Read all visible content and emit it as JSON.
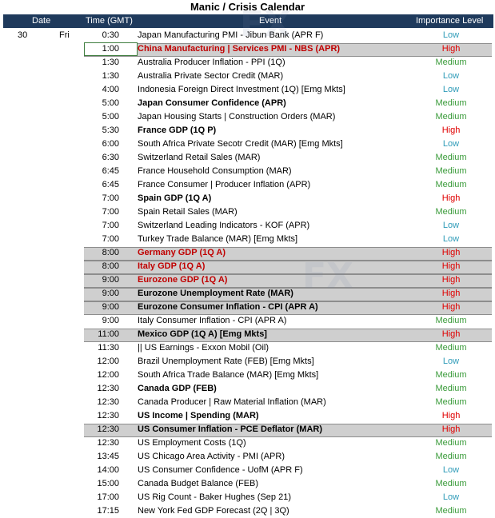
{
  "title": "Manic / Crisis Calendar",
  "headers": {
    "date": "Date",
    "time": "Time (GMT)",
    "event": "Event",
    "importance": "Importance Level"
  },
  "date": {
    "day": "30",
    "weekday": "Fri"
  },
  "rows": [
    {
      "time": "0:30",
      "event": "Japan Manufacturing PMI - Jibun Bank (APR F)",
      "importance": "Low",
      "bold": false,
      "highlight": false,
      "red": false
    },
    {
      "time": "1:00",
      "event": "China Manufacturing | Services PMI - NBS (APR)",
      "importance": "High",
      "bold": true,
      "highlight": true,
      "red": true,
      "selected": true
    },
    {
      "time": "1:30",
      "event": "Australia Producer Inflation - PPI (1Q)",
      "importance": "Medium",
      "bold": false,
      "highlight": false,
      "red": false
    },
    {
      "time": "1:30",
      "event": "Australia Private Sector Credit (MAR)",
      "importance": "Low",
      "bold": false,
      "highlight": false,
      "red": false
    },
    {
      "time": "4:00",
      "event": "Indonesia Foreign Direct Investment (1Q) [Emg Mkts]",
      "importance": "Low",
      "bold": false,
      "highlight": false,
      "red": false
    },
    {
      "time": "5:00",
      "event": "Japan Consumer Confidence (APR)",
      "importance": "Medium",
      "bold": true,
      "highlight": false,
      "red": false
    },
    {
      "time": "5:00",
      "event": "Japan Housing Starts | Construction Orders (MAR)",
      "importance": "Medium",
      "bold": false,
      "highlight": false,
      "red": false
    },
    {
      "time": "5:30",
      "event": "France GDP (1Q P)",
      "importance": "High",
      "bold": true,
      "highlight": false,
      "red": false
    },
    {
      "time": "6:00",
      "event": "South Africa Private Secotr Credit (MAR) [Emg Mkts]",
      "importance": "Low",
      "bold": false,
      "highlight": false,
      "red": false
    },
    {
      "time": "6:30",
      "event": "Switzerland Retail Sales (MAR)",
      "importance": "Medium",
      "bold": false,
      "highlight": false,
      "red": false
    },
    {
      "time": "6:45",
      "event": "France Household Consumption (MAR)",
      "importance": "Medium",
      "bold": false,
      "highlight": false,
      "red": false
    },
    {
      "time": "6:45",
      "event": "France Consumer | Producer Inflation (APR)",
      "importance": "Medium",
      "bold": false,
      "highlight": false,
      "red": false
    },
    {
      "time": "7:00",
      "event": "Spain GDP (1Q A)",
      "importance": "High",
      "bold": true,
      "highlight": false,
      "red": false
    },
    {
      "time": "7:00",
      "event": "Spain Retail Sales (MAR)",
      "importance": "Medium",
      "bold": false,
      "highlight": false,
      "red": false
    },
    {
      "time": "7:00",
      "event": "Switzerland Leading Indicators - KOF (APR)",
      "importance": "Low",
      "bold": false,
      "highlight": false,
      "red": false
    },
    {
      "time": "7:00",
      "event": "Turkey Trade Balance (MAR) [Emg Mkts]",
      "importance": "Low",
      "bold": false,
      "highlight": false,
      "red": false
    },
    {
      "time": "8:00",
      "event": "Germany GDP (1Q A)",
      "importance": "High",
      "bold": true,
      "highlight": true,
      "red": true
    },
    {
      "time": "8:00",
      "event": "Italy GDP (1Q A)",
      "importance": "High",
      "bold": true,
      "highlight": true,
      "red": true
    },
    {
      "time": "9:00",
      "event": "Eurozone GDP (1Q A)",
      "importance": "High",
      "bold": true,
      "highlight": true,
      "red": true
    },
    {
      "time": "9:00",
      "event": "Eurozone Unemployment Rate (MAR)",
      "importance": "High",
      "bold": true,
      "highlight": true,
      "red": false
    },
    {
      "time": "9:00",
      "event": "Eurozone Consumer Inflation - CPI (APR A)",
      "importance": "High",
      "bold": true,
      "highlight": true,
      "red": false
    },
    {
      "time": "9:00",
      "event": "Italy Consumer Inflation - CPI (APR A)",
      "importance": "Medium",
      "bold": false,
      "highlight": false,
      "red": false
    },
    {
      "time": "11:00",
      "event": "Mexico GDP (1Q A) [Emg Mkts]",
      "importance": "High",
      "bold": true,
      "highlight": true,
      "red": false
    },
    {
      "time": "11:30",
      "event": "|| US Earnings - Exxon Mobil (Oil)",
      "importance": "Medium",
      "bold": false,
      "highlight": false,
      "red": false
    },
    {
      "time": "12:00",
      "event": "Brazil Unemployment Rate (FEB) [Emg Mkts]",
      "importance": "Low",
      "bold": false,
      "highlight": false,
      "red": false
    },
    {
      "time": "12:00",
      "event": "South Africa Trade Balance (MAR) [Emg Mkts]",
      "importance": "Medium",
      "bold": false,
      "highlight": false,
      "red": false
    },
    {
      "time": "12:30",
      "event": "Canada GDP (FEB)",
      "importance": "Medium",
      "bold": true,
      "highlight": false,
      "red": false
    },
    {
      "time": "12:30",
      "event": "Canada Producer | Raw Material Inflation (MAR)",
      "importance": "Medium",
      "bold": false,
      "highlight": false,
      "red": false
    },
    {
      "time": "12:30",
      "event": "US Income | Spending (MAR)",
      "importance": "High",
      "bold": true,
      "highlight": false,
      "red": false
    },
    {
      "time": "12:30",
      "event": "US Consumer Inflation - PCE Deflator (MAR)",
      "importance": "High",
      "bold": true,
      "highlight": true,
      "red": false
    },
    {
      "time": "12:30",
      "event": "US Employment Costs (1Q)",
      "importance": "Medium",
      "bold": false,
      "highlight": false,
      "red": false
    },
    {
      "time": "13:45",
      "event": "US Chicago Area Activity - PMI (APR)",
      "importance": "Medium",
      "bold": false,
      "highlight": false,
      "red": false
    },
    {
      "time": "14:00",
      "event": "US Consumer Confidence - UofM (APR F)",
      "importance": "Low",
      "bold": false,
      "highlight": false,
      "red": false
    },
    {
      "time": "15:00",
      "event": "Canada Budget Balance (FEB)",
      "importance": "Medium",
      "bold": false,
      "highlight": false,
      "red": false
    },
    {
      "time": "17:00",
      "event": "US Rig Count - Baker Hughes (Sep 21)",
      "importance": "Low",
      "bold": false,
      "highlight": false,
      "red": false
    },
    {
      "time": "17:15",
      "event": "New York Fed GDP Forecast (2Q | 3Q)",
      "importance": "Medium",
      "bold": false,
      "highlight": false,
      "red": false
    }
  ]
}
